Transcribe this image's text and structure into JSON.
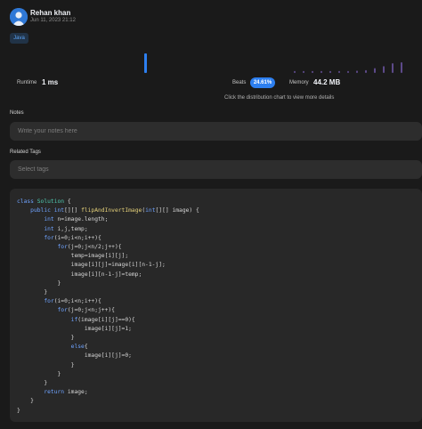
{
  "header": {
    "user_name": "Rehan khan",
    "submit_date": "Jun 11, 2023 21:12"
  },
  "language_tag": "Java",
  "stats": {
    "runtime_label": "Runtime",
    "runtime_value": "1 ms",
    "beats_label": "Beats",
    "beats_value": "24.61%",
    "memory_label": "Memory",
    "memory_value": "44.2 MB",
    "distribution_hint": "Click the distribution chart to view more details"
  },
  "distribution": {
    "runtime_level": 1.0,
    "memory_levels": [
      0.1,
      0.1,
      0.1,
      0.1,
      0.1,
      0.1,
      0.1,
      0.12,
      0.15,
      0.25,
      0.35,
      0.5,
      0.55
    ]
  },
  "notes": {
    "label": "Notes",
    "placeholder": "Write your notes here"
  },
  "tags": {
    "label": "Related Tags",
    "placeholder": "Select tags"
  },
  "code": [
    "class Solution {",
    "    public int[][] flipAndInvertImage(int[][] image) {",
    "        int n=image.length;",
    "        int i,j,temp;",
    "        for(i=0;i<n;i++){",
    "            for(j=0;j<n/2;j++){",
    "                temp=image[i][j];",
    "                image[i][j]=image[i][n-1-j];",
    "                image[i][n-1-j]=temp;",
    "            }",
    "        }",
    "        for(i=0;i<n;i++){",
    "            for(j=0;j<n;j++){",
    "                if(image[i][j]==0){",
    "                    image[i][j]=1;",
    "                }",
    "                else{",
    "                    image[i][j]=0;",
    "                }",
    "            }",
    "        }",
    "        return image;",
    "    }",
    "}"
  ],
  "colors": {
    "accent": "#2d7ff0",
    "runtime_bar": "#2d7ff0",
    "memory_bar": "#5d4a8a"
  }
}
